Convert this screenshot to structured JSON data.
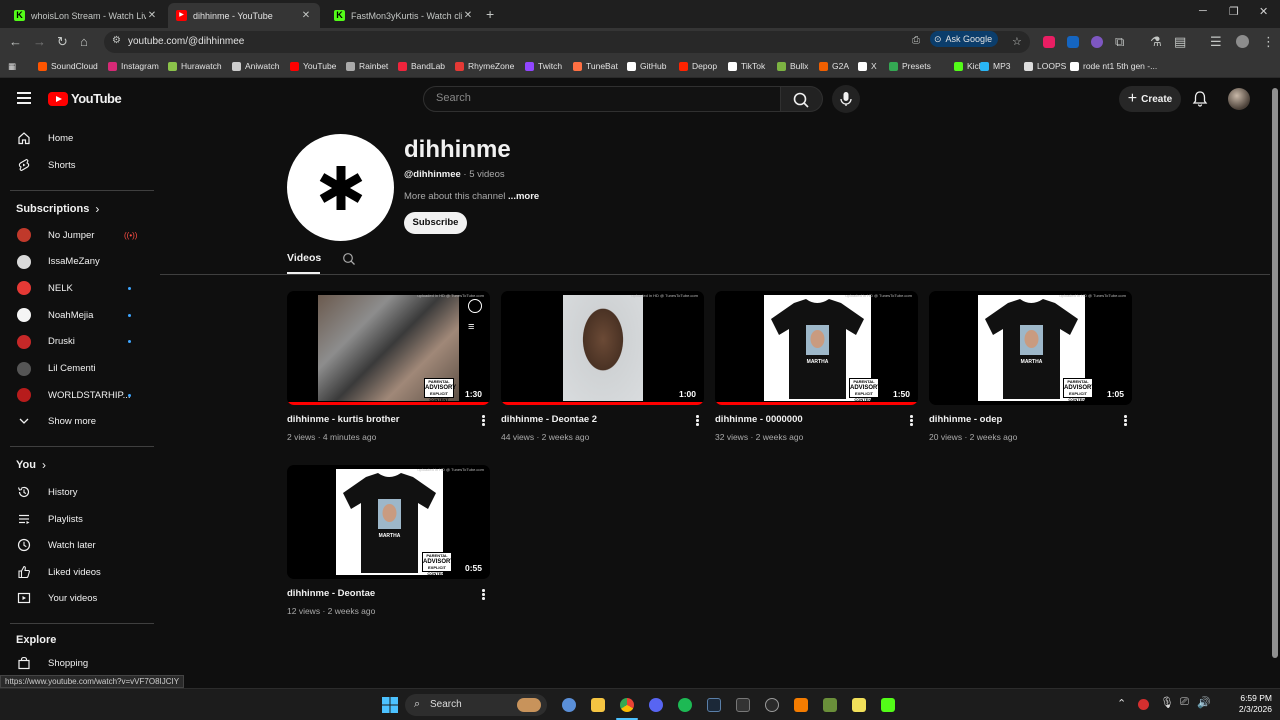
{
  "browser": {
    "tabs": [
      {
        "title": "whoisLon Stream - Watch Live o",
        "favicon": "kick-icon",
        "color": "#53fc18",
        "active": false
      },
      {
        "title": "dihhinme - YouTube",
        "favicon": "youtube-icon",
        "color": "#ff0000",
        "active": true
      },
      {
        "title": "FastMon3yKurtis - Watch clips o",
        "favicon": "kick-icon",
        "color": "#53fc18",
        "active": false
      }
    ],
    "url": "youtube.com/@dihhinmee",
    "ask_google": "Ask Google",
    "bookmarks": [
      {
        "label": "SoundCloud",
        "color": "#ff5500"
      },
      {
        "label": "Instagram",
        "color": "#d62976"
      },
      {
        "label": "Hurawatch",
        "color": "#8bc34a"
      },
      {
        "label": "Aniwatch",
        "color": "#cccccc"
      },
      {
        "label": "YouTube",
        "color": "#ff0000"
      },
      {
        "label": "Rainbet",
        "color": "#aaaaaa"
      },
      {
        "label": "BandLab",
        "color": "#f0243c"
      },
      {
        "label": "RhymeZone",
        "color": "#e53935"
      },
      {
        "label": "Twitch",
        "color": "#9146ff"
      },
      {
        "label": "TuneBat",
        "color": "#ff7043"
      },
      {
        "label": "GitHub",
        "color": "#ffffff"
      },
      {
        "label": "Depop",
        "color": "#ff2300"
      },
      {
        "label": "TikTok",
        "color": "#ffffff"
      },
      {
        "label": "Bullx",
        "color": "#7cb342"
      },
      {
        "label": "G2A",
        "color": "#f05f00"
      },
      {
        "label": "X",
        "color": "#ffffff"
      },
      {
        "label": "Presets",
        "color": "#34a853"
      },
      {
        "label": "Kick",
        "color": "#53fc18"
      },
      {
        "label": "MP3",
        "color": "#29b6f6"
      },
      {
        "label": "LOOPS",
        "color": "#dddddd"
      },
      {
        "label": "rode nt1 5th gen -...",
        "color": "#ffffff"
      }
    ]
  },
  "youtube": {
    "logo": "YouTube",
    "search_placeholder": "Search",
    "create_label": "Create"
  },
  "sidebar": {
    "main": [
      {
        "label": "Home",
        "icon": "home-icon"
      },
      {
        "label": "Shorts",
        "icon": "shorts-icon"
      }
    ],
    "subscriptions_title": "Subscriptions",
    "subscriptions": [
      {
        "label": "No Jumper",
        "color": "#c0392b",
        "status": "live"
      },
      {
        "label": "IssaMeZany",
        "color": "#d9d9d9",
        "status": ""
      },
      {
        "label": "NELK",
        "color": "#e53935",
        "status": "dot"
      },
      {
        "label": "NoahMejia",
        "color": "#f5f5f5",
        "status": "dot"
      },
      {
        "label": "Druski",
        "color": "#c62828",
        "status": "dot"
      },
      {
        "label": "Lil Cementi",
        "color": "#555555",
        "status": ""
      },
      {
        "label": "WORLDSTARHIP...",
        "color": "#b71c1c",
        "status": "dot"
      }
    ],
    "show_more": "Show more",
    "you_title": "You",
    "you": [
      {
        "label": "History",
        "icon": "history-icon"
      },
      {
        "label": "Playlists",
        "icon": "playlists-icon"
      },
      {
        "label": "Watch later",
        "icon": "watch-later-icon"
      },
      {
        "label": "Liked videos",
        "icon": "like-icon"
      },
      {
        "label": "Your videos",
        "icon": "your-videos-icon"
      }
    ],
    "explore_title": "Explore",
    "explore": [
      {
        "label": "Shopping",
        "icon": "shopping-icon"
      }
    ]
  },
  "channel": {
    "name": "dihhinme",
    "handle": "@dihhinmee",
    "video_count": "5 videos",
    "about": "More about this channel",
    "about_more": "...more",
    "subscribe": "Subscribe",
    "tab_videos": "Videos"
  },
  "videos": [
    {
      "title": "dihhinme - kurtis brother",
      "views": "2 views",
      "age": "4 minutes ago",
      "duration": "1:30",
      "thumb": "collage",
      "watched": 1.0
    },
    {
      "title": "dihhinme - Deontae 2",
      "views": "44 views",
      "age": "2 weeks ago",
      "duration": "1:00",
      "thumb": "face",
      "watched": 1.0
    },
    {
      "title": "dihhinme - 0000000",
      "views": "32 views",
      "age": "2 weeks ago",
      "duration": "1:50",
      "thumb": "tshirt",
      "watched": 1.0
    },
    {
      "title": "dihhinme - odep",
      "views": "20 views",
      "age": "2 weeks ago",
      "duration": "1:05",
      "thumb": "tshirt",
      "watched": 0
    },
    {
      "title": "dihhinme - Deontae",
      "views": "12 views",
      "age": "2 weeks ago",
      "duration": "0:55",
      "thumb": "tshirt",
      "watched": 0
    }
  ],
  "thumb_text": {
    "watermark": "uploaded in HD @ TunesToTube.com",
    "shirt_label": "MARTHA",
    "advisory_top": "PARENTAL",
    "advisory_mid": "ADVISORY",
    "advisory_bot": "EXPLICIT CONTENT"
  },
  "status_url": "https://www.youtube.com/watch?v=vVF7O8IJCIY",
  "taskbar": {
    "search": "Search",
    "time": "6:59 PM",
    "date": "2/3/2026"
  }
}
